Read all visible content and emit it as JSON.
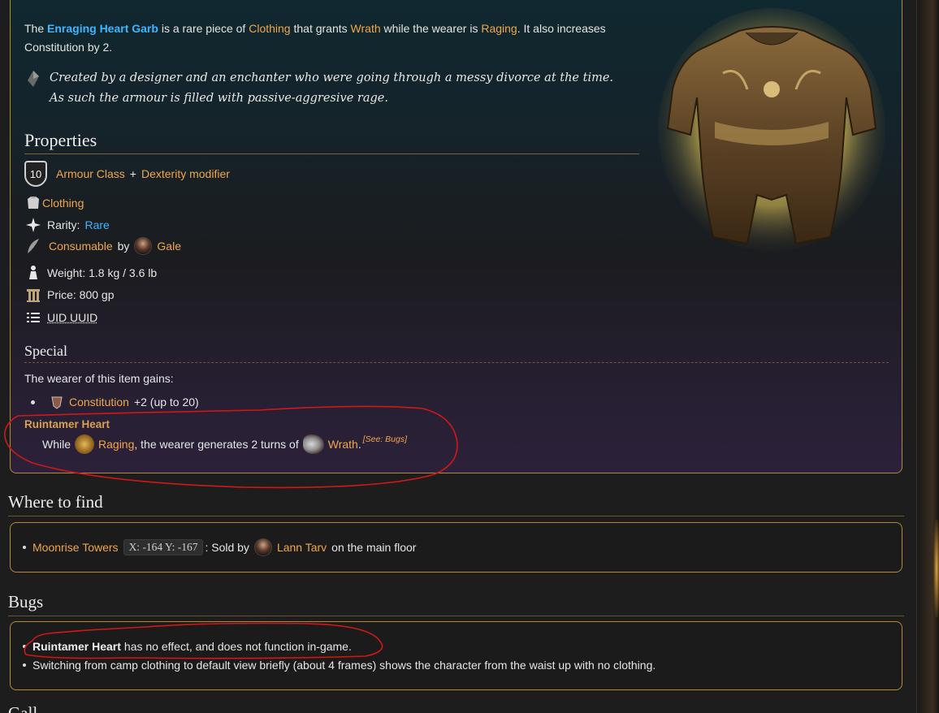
{
  "intro": {
    "the": "The",
    "item_name": "Enraging Heart Garb",
    "is_a": "is a rare piece of",
    "clothing_link": "Clothing",
    "that_grants": "that grants",
    "wrath_link": "Wrath",
    "while": "while the wearer is",
    "raging_link": "Raging",
    "tail": ". It also increases Constitution by 2."
  },
  "quote": "Created by a designer and an enchanter who were going through a messy divorce at the time. As such the armour is filled with passive-aggresive rage.",
  "properties": {
    "heading": "Properties",
    "ac_value": "10",
    "armour_class": "Armour Class",
    "plus": "+",
    "dex_mod": "Dexterity modifier",
    "type": "Clothing",
    "rarity_label": "Rarity:",
    "rarity_value": "Rare",
    "consumable": "Consumable",
    "by": "by",
    "gale": "Gale",
    "weight": "Weight: 1.8 kg / 3.6 lb",
    "price": "Price: 800 gp",
    "uid": "UID UUID"
  },
  "special": {
    "heading": "Special",
    "sub": "The wearer of this item gains:",
    "constitution": "Constitution",
    "constitution_bonus": "+2 (up to 20)",
    "rt_title": "Ruintamer Heart",
    "rt_while": "While",
    "rt_raging": "Raging",
    "rt_mid": ", the wearer generates 2 turns of",
    "rt_wrath": "Wrath",
    "rt_period": ".",
    "rt_see": "[See: Bugs]"
  },
  "where": {
    "heading": "Where to find",
    "location": "Moonrise Towers",
    "coords": "X: -164 Y: -167",
    "sold_by": ": Sold by",
    "vendor": "Lann Tarv",
    "floor": "on the main floor"
  },
  "bugs": {
    "heading": "Bugs",
    "bug1_bold": "Ruintamer Heart",
    "bug1_rest": "has no effect, and does not function in-game.",
    "bug2": "Switching from camp clothing to default view briefly (about 4 frames) shows the character from the waist up with no clothing."
  },
  "next_heading_partial": "Gall",
  "colors": {
    "link": "#f0a64b",
    "item_name": "#3fb6ff",
    "border": "#b38a35",
    "annotation": "#d01818"
  }
}
